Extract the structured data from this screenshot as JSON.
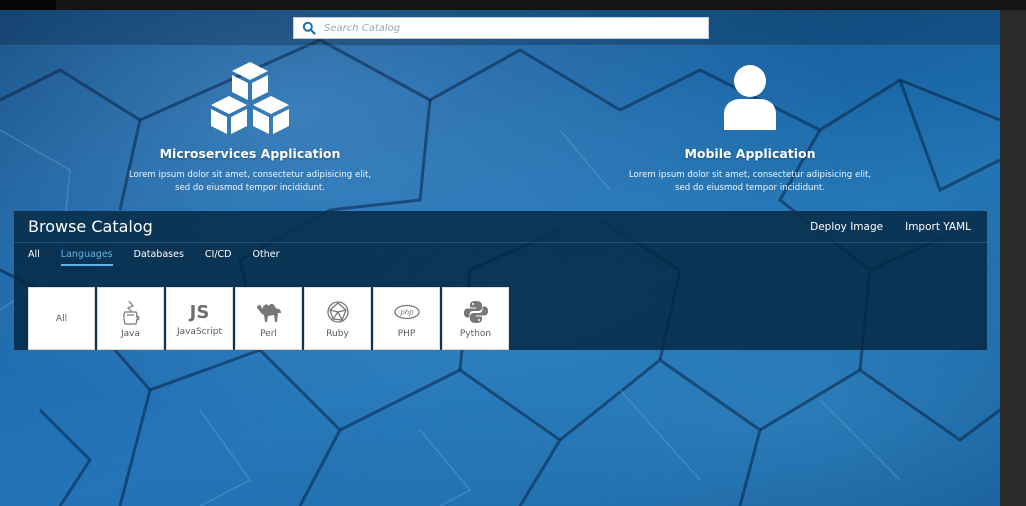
{
  "search": {
    "placeholder": "Search Catalog"
  },
  "features": [
    {
      "icon": "cubes-icon",
      "title": "Microservices Application",
      "desc_line1": "Lorem ipsum dolor sit amet, consectetur adipisicing elit,",
      "desc_line2": "sed do eiusmod tempor incididunt."
    },
    {
      "icon": "user-icon",
      "title": "Mobile Application",
      "desc_line1": "Lorem ipsum dolor sit amet, consectetur adipisicing elit,",
      "desc_line2": "sed do eiusmod tempor incididunt."
    }
  ],
  "catalog": {
    "title": "Browse Catalog",
    "actions": {
      "deploy": "Deploy Image",
      "import": "Import YAML"
    },
    "tabs": [
      "All",
      "Languages",
      "Databases",
      "CI/CD",
      "Other"
    ],
    "active_tab": "Languages",
    "tiles": [
      {
        "label": "All",
        "icon": ""
      },
      {
        "label": "Java",
        "icon": "java-icon"
      },
      {
        "label": "JavaScript",
        "icon": "js-icon",
        "glyph": "JS"
      },
      {
        "label": "Perl",
        "icon": "camel-icon"
      },
      {
        "label": "Ruby",
        "icon": "ruby-icon"
      },
      {
        "label": "PHP",
        "icon": "php-icon",
        "glyph": "php"
      },
      {
        "label": "Python",
        "icon": "python-icon"
      }
    ]
  },
  "colors": {
    "accent": "#5fb3ea",
    "panel": "#04263e",
    "hero": "#17609f"
  }
}
